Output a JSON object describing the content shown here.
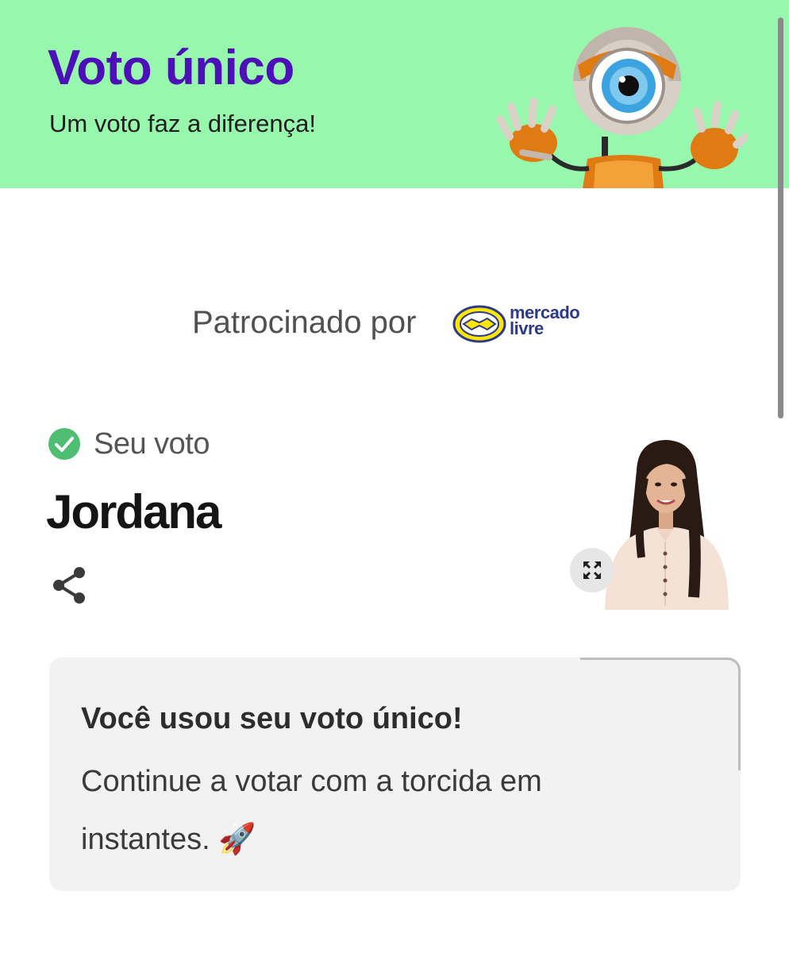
{
  "header": {
    "title": "Voto único",
    "subtitle": "Um voto faz a diferença!",
    "mascot_icon": "big-brother-robot-eye-icon",
    "background": "#97f8ad",
    "title_color": "#4d0fb8"
  },
  "sponsor": {
    "label": "Patrocinado por",
    "brand_line1": "mercado",
    "brand_line2": "livre",
    "logo_icon": "mercado-livre-handshake-icon"
  },
  "vote": {
    "status_icon": "check-circle-icon",
    "status_label": "Seu voto",
    "candidate_name": "Jordana",
    "share_icon": "share-icon",
    "expand_icon": "expand-icon"
  },
  "card": {
    "title": "Você usou seu voto único!",
    "body": "Continue a votar com a torcida em instantes. 🚀"
  }
}
